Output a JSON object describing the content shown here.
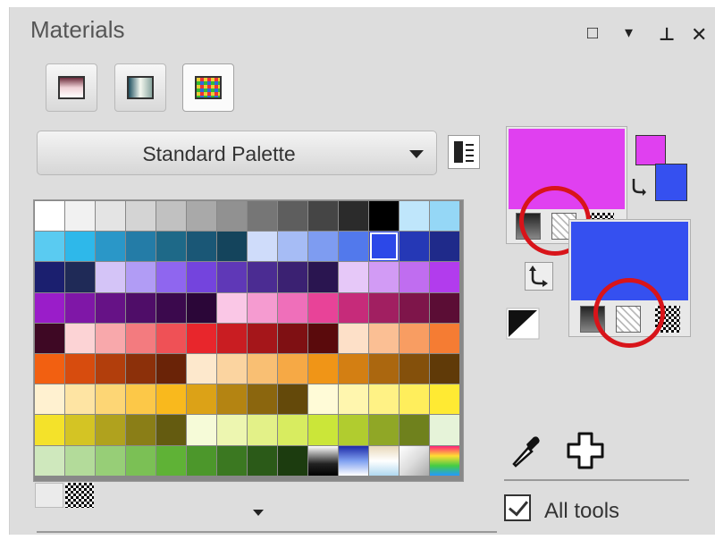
{
  "panel": {
    "title": "Materials",
    "controls": {
      "restore": "□",
      "menu": "▾",
      "pin": "⊥",
      "close": "✕"
    }
  },
  "mode_buttons": [
    {
      "name": "color-mode",
      "icon": "gradient-square-icon"
    },
    {
      "name": "gradient-mode",
      "icon": "gradient-rect-icon"
    },
    {
      "name": "swatch-mode",
      "icon": "grid-swatch-icon",
      "active": true
    }
  ],
  "palette_select": {
    "selected": "Standard Palette"
  },
  "palette_colors": [
    [
      "#ffffff",
      "#f1f1f1",
      "#e4e4e4",
      "#d4d4d4",
      "#c1c1c1",
      "#a9a9a9",
      "#919191",
      "#767676",
      "#5e5e5e",
      "#454545",
      "#2b2b2b",
      "#000000",
      "#bfe6fb",
      "#95d7f6"
    ],
    [
      "#5acbf1",
      "#2eb8ea",
      "#2a97c8",
      "#247ca7",
      "#1e6988",
      "#1a5776",
      "#14445c",
      "#cfdcfa",
      "#a6bcf5",
      "#7e9cf1",
      "#5279ec",
      "#2c48e8",
      "#2538b6",
      "#1f2a8a"
    ],
    [
      "#1b1f6f",
      "#1f2a57",
      "#d4c4f7",
      "#b19cf5",
      "#8f66ef",
      "#7444dd",
      "#5f38b7",
      "#4b2c92",
      "#3b2172",
      "#2a1550",
      "#e6c8f8",
      "#d29bf5",
      "#c06df0",
      "#b23ced"
    ],
    [
      "#9a1dc9",
      "#7f17a7",
      "#661286",
      "#4f0d68",
      "#3b094d",
      "#2b0638",
      "#fac7e6",
      "#f59bd0",
      "#ef6fba",
      "#e84398",
      "#c62b7a",
      "#a11f61",
      "#7e154a",
      "#5b0d35"
    ],
    [
      "#3e0824",
      "#fcd3d5",
      "#f8a8ab",
      "#f37b7f",
      "#ef5156",
      "#e8262c",
      "#c91d22",
      "#a5161a",
      "#7f1013",
      "#5a0a0c",
      "#fde0c8",
      "#fbbf94",
      "#f89d62",
      "#f57c33"
    ],
    [
      "#f26011",
      "#d74c0e",
      "#b23e0c",
      "#8c300a",
      "#6a2307",
      "#fde8cc",
      "#fbd4a0",
      "#f9bf73",
      "#f6a945",
      "#f09517",
      "#d37f13",
      "#ab670f",
      "#84500b",
      "#603a08"
    ],
    [
      "#fff1d0",
      "#fee4a3",
      "#fdd675",
      "#fcc848",
      "#f9b91d",
      "#dca217",
      "#b48412",
      "#8b660e",
      "#64490a",
      "#fffbd7",
      "#fff6ae",
      "#fff285",
      "#ffee5c",
      "#ffea33"
    ],
    [
      "#f4e22a",
      "#d4c424",
      "#b0a21e",
      "#8a7e17",
      "#645b10",
      "#f6fbd8",
      "#edf6b0",
      "#e3f188",
      "#d8ec60",
      "#cbe639",
      "#b1cc2f",
      "#90a726",
      "#6f811d",
      "#e6f3d9"
    ],
    [
      "#cfe8bd",
      "#b3db9a",
      "#97ce77",
      "#7bc055",
      "#5fb236",
      "#4c972b",
      "#3b7821",
      "#2b5a18",
      "#1c3c0f",
      "GRAD1",
      "GRAD2",
      "GRAD3",
      "GRAD4",
      "GRAD5"
    ]
  ],
  "colors": {
    "foreground": "#e040f0",
    "background": "#3550f0",
    "highlight": "#d8141a"
  },
  "tools": {
    "dropper_icon": "eyedropper-icon",
    "add_icon": "plus-outline-icon"
  },
  "all_tools": {
    "label": "All tools",
    "checked": true
  }
}
